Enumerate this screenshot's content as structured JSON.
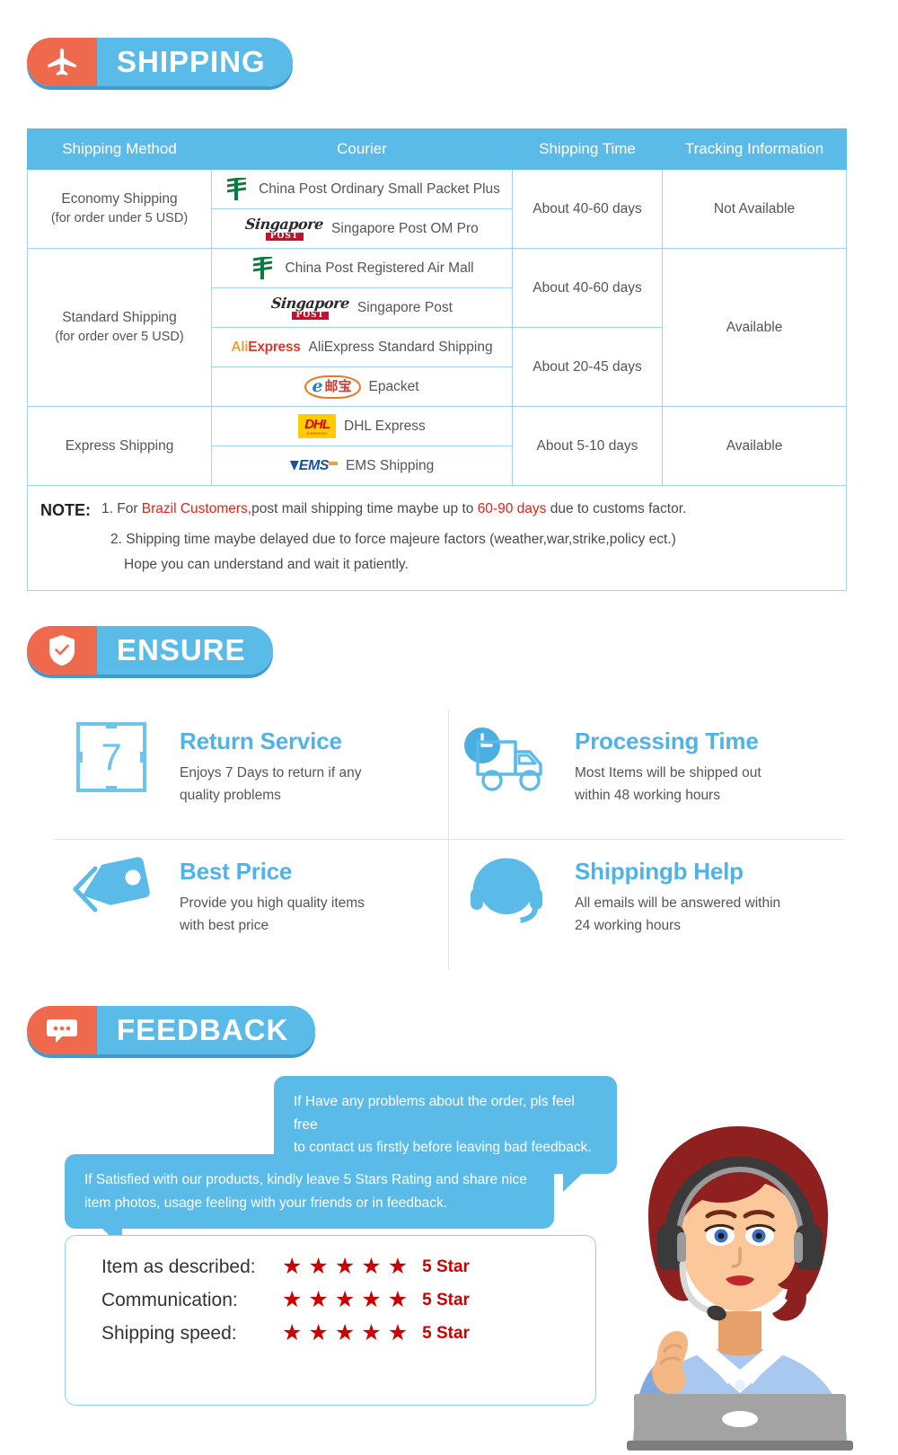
{
  "sections": {
    "shipping": {
      "label": "SHIPPING",
      "icon": "airplane-icon"
    },
    "ensure": {
      "label": "ENSURE",
      "icon": "shield-check-icon"
    },
    "feedback": {
      "label": "FEEDBACK",
      "icon": "chat-bubble-icon"
    }
  },
  "colors": {
    "accent_blue": "#5bbbe8",
    "accent_orange": "#ef6a4d",
    "title_blue": "#4fb3e8",
    "star_red": "#cc0000",
    "note_red": "#e2231a"
  },
  "shipping_table": {
    "headers": [
      "Shipping Method",
      "Courier",
      "Shipping Time",
      "Tracking Information"
    ],
    "rows": [
      {
        "method": "Economy Shipping",
        "method_sub": "(for order under 5 USD)",
        "couriers": [
          {
            "logo": "china-post-logo",
            "name": "China Post Ordinary Small Packet Plus"
          },
          {
            "logo": "singapore-post-logo",
            "name": "Singapore Post OM Pro"
          }
        ],
        "times": [
          "About 40-60 days"
        ],
        "tracking": "Not Available"
      },
      {
        "method": "Standard Shipping",
        "method_sub": "(for order over 5 USD)",
        "couriers": [
          {
            "logo": "china-post-logo",
            "name": "China Post Registered Air Mall"
          },
          {
            "logo": "singapore-post-logo",
            "name": "Singapore Post"
          },
          {
            "logo": "aliexpress-logo",
            "name": "AliExpress Standard Shipping"
          },
          {
            "logo": "epacket-logo",
            "name": "Epacket"
          }
        ],
        "times": [
          "About 40-60 days",
          "About 20-45 days"
        ],
        "tracking": "Available"
      },
      {
        "method": "Express Shipping",
        "method_sub": "",
        "couriers": [
          {
            "logo": "dhl-logo",
            "name": "DHL Express"
          },
          {
            "logo": "ems-logo",
            "name": "EMS Shipping"
          }
        ],
        "times": [
          "About 5-10 days"
        ],
        "tracking": "Available"
      }
    ],
    "note": {
      "title": "NOTE:",
      "line1_a": "1. For ",
      "line1_red1": "Brazil Customers",
      "line1_b": ",post mail shipping time maybe up to ",
      "line1_red2": "60-90 days",
      "line1_c": " due to customs factor.",
      "line2": "2. Shipping time maybe delayed due to force majeure factors (weather,war,strike,policy ect.)",
      "line3": "Hope you can understand and wait it patiently."
    },
    "logo_text": {
      "singapore_script": "Singapore",
      "singapore_post": "POST",
      "ali_a": "Ali",
      "ali_b": "Express",
      "epacket_e": "e",
      "epacket_cn": "邮宝",
      "dhl_main": "DHL",
      "dhl_sub": "EXPRESS",
      "ems_text": "EMS"
    }
  },
  "ensure_features": [
    {
      "icon": "seven-day-box-icon",
      "number": "7",
      "title": "Return Service",
      "desc_l1": "Enjoys 7 Days to return if any",
      "desc_l2": "quality problems"
    },
    {
      "icon": "truck-clock-icon",
      "title": "Processing Time",
      "desc_l1": "Most Items will be shipped out",
      "desc_l2": "within 48 working hours"
    },
    {
      "icon": "price-tag-icon",
      "title": "Best Price",
      "desc_l1": "Provide you high quality items",
      "desc_l2": "with best price"
    },
    {
      "icon": "headset-support-icon",
      "title": "Shippingb Help",
      "desc_l1": "All emails will be answered within",
      "desc_l2": "24 working hours"
    }
  ],
  "feedback": {
    "bubble_top_l1": "If Have any problems about the order, pls feel free",
    "bubble_top_l2": "to contact us firstly before leaving bad feedback.",
    "bubble_bottom_l1": "If Satisfied with our products, kindly leave 5 Stars Rating and share nice",
    "bubble_bottom_l2": "item photos, usage feeling with your friends or in feedback.",
    "ratings": [
      {
        "label": "Item as described:",
        "stars": 5,
        "value": "5 Star"
      },
      {
        "label": "Communication:",
        "stars": 5,
        "value": "5 Star"
      },
      {
        "label": "Shipping speed:",
        "stars": 5,
        "value": "5 Star"
      }
    ],
    "star_glyph": "★",
    "agent_illustration": "customer-service-agent-illustration"
  }
}
